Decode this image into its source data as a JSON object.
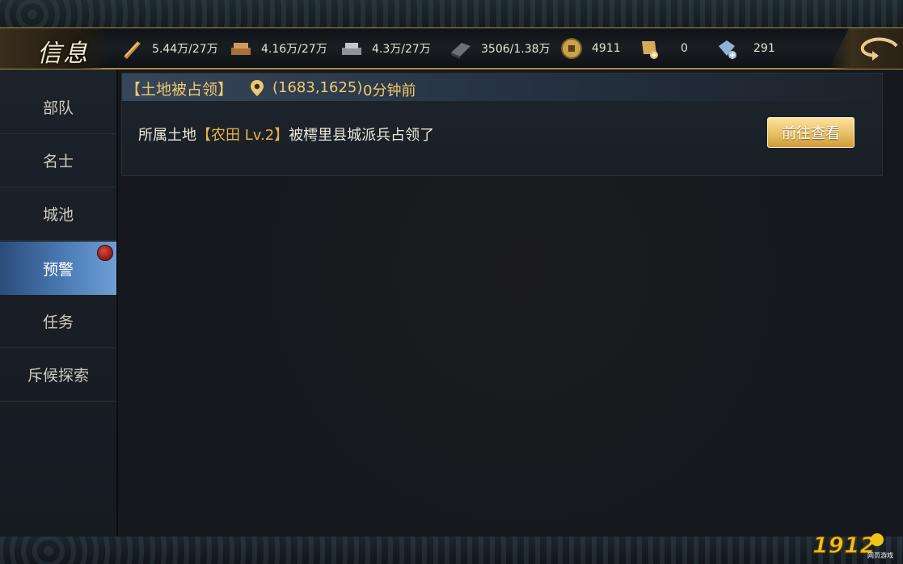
{
  "header": {
    "title": "信息",
    "resources": [
      {
        "icon": "wood-icon",
        "value": "5.44万/27万"
      },
      {
        "icon": "lumber-icon",
        "value": "4.16万/27万"
      },
      {
        "icon": "stone-icon",
        "value": "4.3万/27万"
      },
      {
        "icon": "iron-icon",
        "value": "3506/1.38万"
      },
      {
        "icon": "coin-icon",
        "value": "4911"
      },
      {
        "icon": "scroll-icon",
        "value": "0"
      },
      {
        "icon": "jade-icon",
        "value": "291"
      }
    ]
  },
  "sidebar": {
    "items": [
      {
        "label": "部队",
        "active": false
      },
      {
        "label": "名士",
        "active": false
      },
      {
        "label": "城池",
        "active": false
      },
      {
        "label": "预警",
        "active": true,
        "badge": true
      },
      {
        "label": "任务",
        "active": false
      },
      {
        "label": "斥候探索",
        "active": false
      }
    ]
  },
  "alert": {
    "title": "【土地被占领】",
    "coords": "(1683,1625)",
    "time": "0分钟前",
    "message_prefix": "所属土地",
    "message_highlight": "【农田 Lv.2】",
    "message_suffix": "被樗里县城派兵占领了",
    "button_label": "前往查看"
  },
  "watermark": {
    "text": "1912",
    "subtext": "网页游戏"
  },
  "colors": {
    "accent_gold": "#f0c96a",
    "active_nav": "#4e7fb9",
    "badge_red": "#c1342a"
  }
}
